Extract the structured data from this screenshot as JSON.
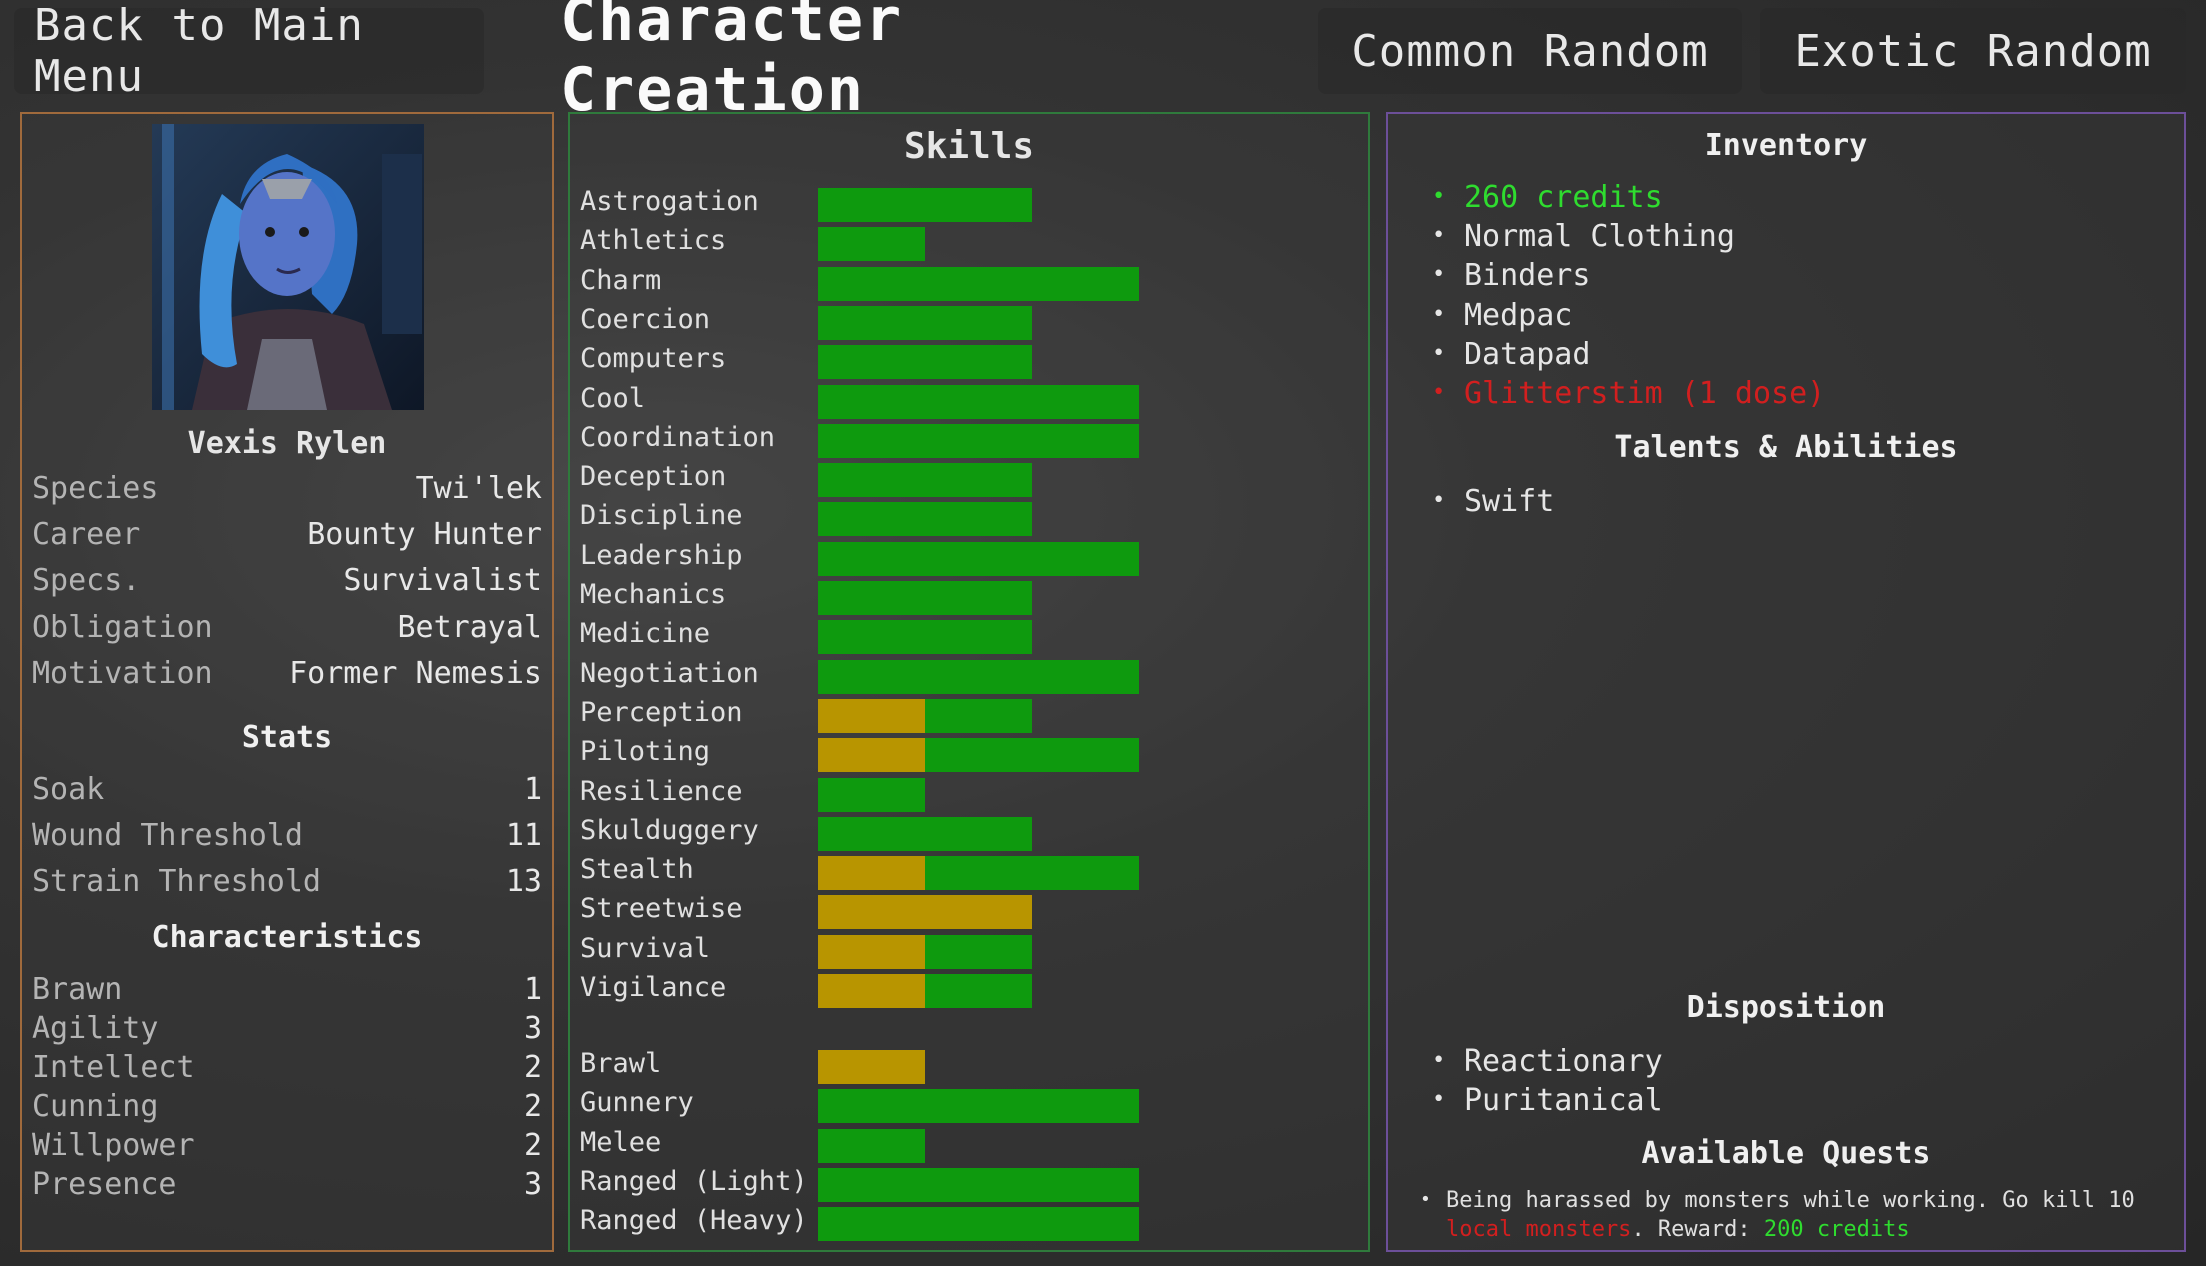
{
  "header": {
    "back_label": "Back to Main Menu",
    "title": "Character Creation",
    "common_random_label": "Common Random",
    "exotic_random_label": "Exotic Random"
  },
  "character": {
    "name": "Vexis Rylen",
    "info": [
      {
        "label": "Species",
        "value": "Twi'lek"
      },
      {
        "label": "Career",
        "value": "Bounty Hunter"
      },
      {
        "label": "Specs.",
        "value": "Survivalist"
      },
      {
        "label": "Obligation",
        "value": "Betrayal"
      },
      {
        "label": "Motivation",
        "value": "Former Nemesis"
      }
    ],
    "stats_title": "Stats",
    "stats": [
      {
        "label": "Soak",
        "value": "1"
      },
      {
        "label": "Wound Threshold",
        "value": "11"
      },
      {
        "label": "Strain Threshold",
        "value": "13"
      }
    ],
    "characteristics_title": "Characteristics",
    "characteristics": [
      {
        "label": "Brawn",
        "value": "1"
      },
      {
        "label": "Agility",
        "value": "3"
      },
      {
        "label": "Intellect",
        "value": "2"
      },
      {
        "label": "Cunning",
        "value": "2"
      },
      {
        "label": "Willpower",
        "value": "2"
      },
      {
        "label": "Presence",
        "value": "3"
      }
    ]
  },
  "skills_title": "Skills",
  "skills": [
    {
      "name": "Astrogation",
      "yellow": 0,
      "green": 2
    },
    {
      "name": "Athletics",
      "yellow": 0,
      "green": 1
    },
    {
      "name": "Charm",
      "yellow": 0,
      "green": 3
    },
    {
      "name": "Coercion",
      "yellow": 0,
      "green": 2
    },
    {
      "name": "Computers",
      "yellow": 0,
      "green": 2
    },
    {
      "name": "Cool",
      "yellow": 0,
      "green": 3
    },
    {
      "name": "Coordination",
      "yellow": 0,
      "green": 3
    },
    {
      "name": "Deception",
      "yellow": 0,
      "green": 2
    },
    {
      "name": "Discipline",
      "yellow": 0,
      "green": 2
    },
    {
      "name": "Leadership",
      "yellow": 0,
      "green": 3
    },
    {
      "name": "Mechanics",
      "yellow": 0,
      "green": 2
    },
    {
      "name": "Medicine",
      "yellow": 0,
      "green": 2
    },
    {
      "name": "Negotiation",
      "yellow": 0,
      "green": 3
    },
    {
      "name": "Perception",
      "yellow": 1,
      "green": 1
    },
    {
      "name": "Piloting",
      "yellow": 1,
      "green": 2
    },
    {
      "name": "Resilience",
      "yellow": 0,
      "green": 1
    },
    {
      "name": "Skulduggery",
      "yellow": 0,
      "green": 2
    },
    {
      "name": "Stealth",
      "yellow": 1,
      "green": 2
    },
    {
      "name": "Streetwise",
      "yellow": 2,
      "green": 0
    },
    {
      "name": "Survival",
      "yellow": 1,
      "green": 1
    },
    {
      "name": "Vigilance",
      "yellow": 1,
      "green": 1
    }
  ],
  "combat_skills": [
    {
      "name": "Brawl",
      "yellow": 1,
      "green": 0
    },
    {
      "name": "Gunnery",
      "yellow": 0,
      "green": 3
    },
    {
      "name": "Melee",
      "yellow": 0,
      "green": 1
    },
    {
      "name": "Ranged (Light)",
      "yellow": 0,
      "green": 3
    },
    {
      "name": "Ranged (Heavy)",
      "yellow": 0,
      "green": 3
    }
  ],
  "colors": {
    "green": "#0e9a0e",
    "yellow": "#b89500",
    "credits": "#2fdc2f",
    "warning": "#d21f1f"
  },
  "inventory_title": "Inventory",
  "inventory": [
    {
      "text": "260 credits",
      "color": "#2fdc2f"
    },
    {
      "text": "Normal Clothing",
      "color": "#e6e6e6"
    },
    {
      "text": "Binders",
      "color": "#e6e6e6"
    },
    {
      "text": "Medpac",
      "color": "#e6e6e6"
    },
    {
      "text": "Datapad",
      "color": "#e6e6e6"
    },
    {
      "text": "Glitterstim (1 dose)",
      "color": "#d21f1f"
    }
  ],
  "talents_title": "Talents & Abilities",
  "talents": [
    "Swift"
  ],
  "disposition_title": "Disposition",
  "disposition": [
    "Reactionary",
    "Puritanical"
  ],
  "quests_title": "Available Quests",
  "quest": {
    "text_a": "Being harassed by monsters while working. Go kill 10 ",
    "target": "local monsters",
    "text_b": ". Reward: ",
    "reward": "200 credits"
  }
}
